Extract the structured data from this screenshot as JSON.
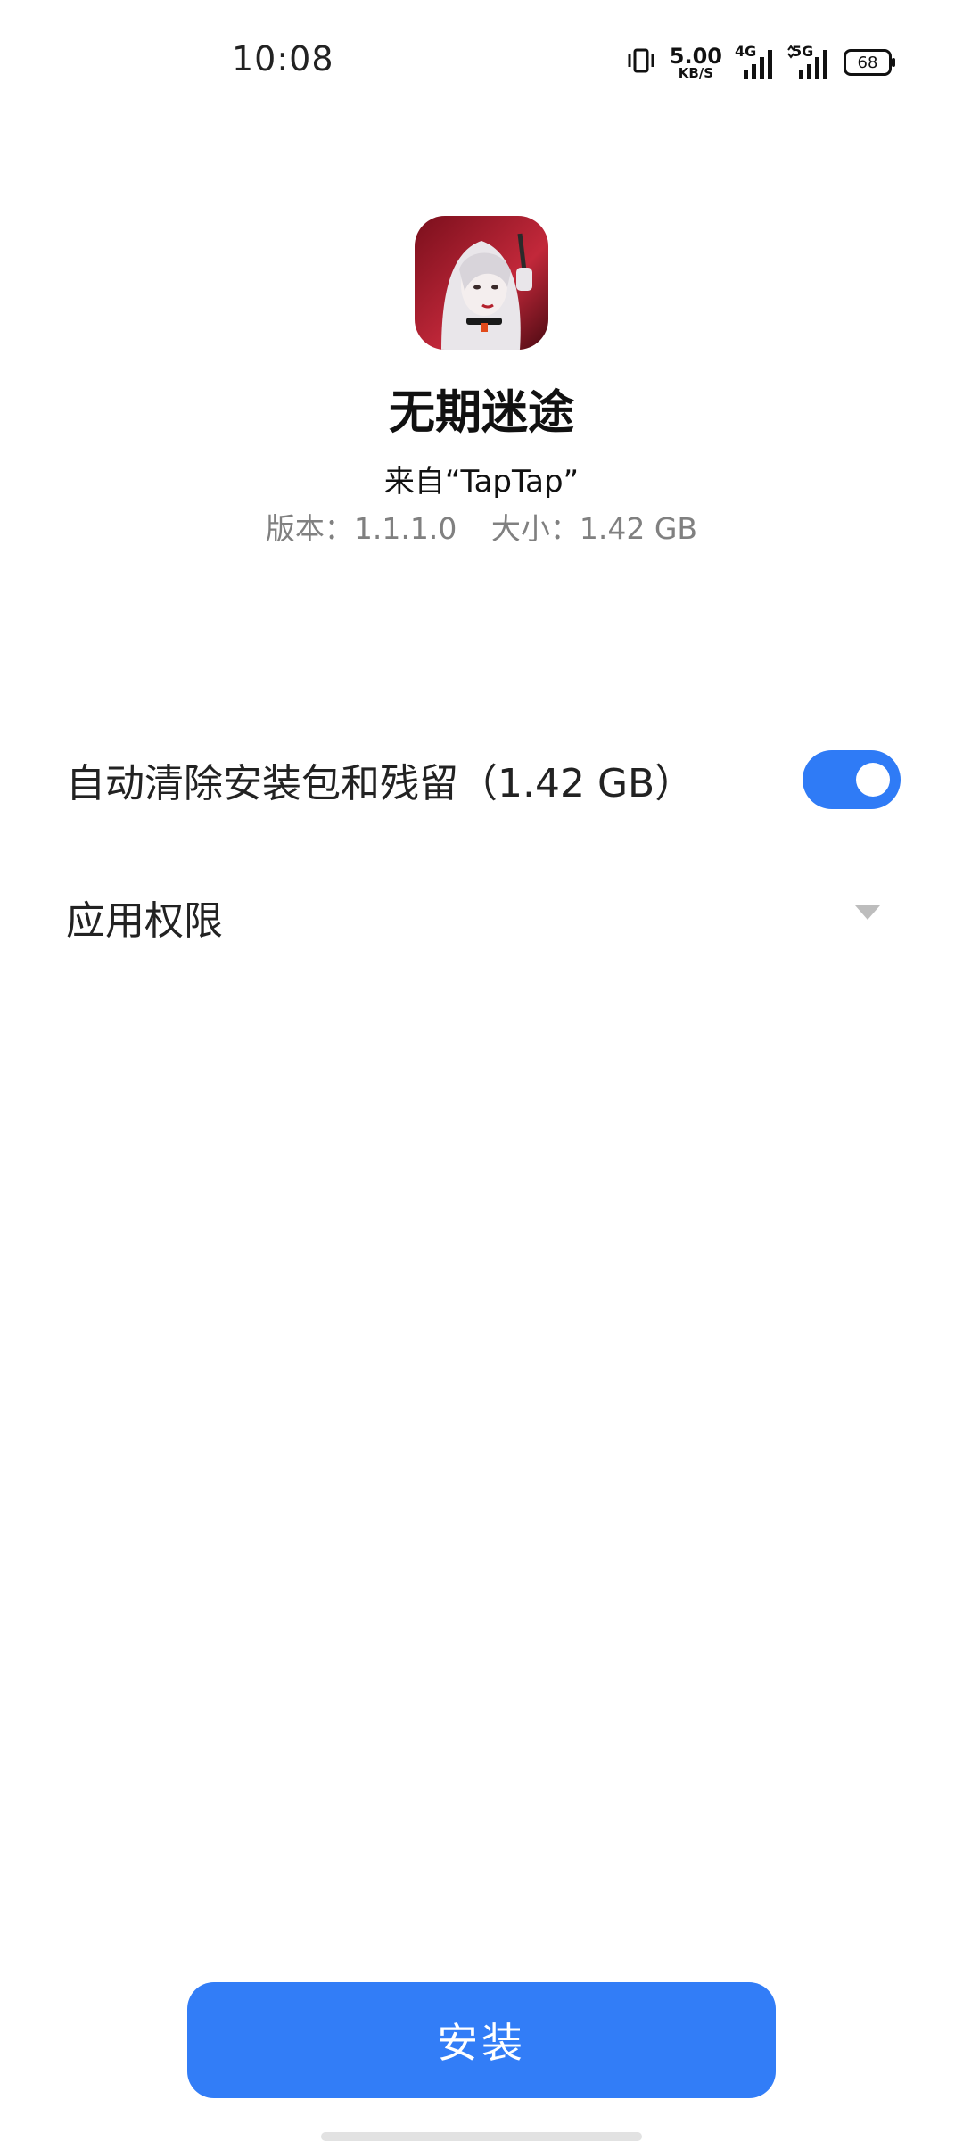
{
  "status_bar": {
    "time": "10:08",
    "net_speed_value": "5.00",
    "net_speed_unit": "KB/S",
    "signal1_label": "4G",
    "signal2_label": "5G",
    "battery": "68",
    "icons": [
      "vibrate-icon",
      "signal-4g-icon",
      "signal-5g-icon",
      "battery-icon"
    ]
  },
  "app": {
    "name": "无期迷途",
    "source": "来自“TapTap”",
    "version": "版本：1.1.1.0",
    "size": "大小：1.42 GB"
  },
  "options": {
    "auto_clean_label": "自动清除安装包和残留（1.42 GB）",
    "auto_clean_enabled": true,
    "permissions_label": "应用权限"
  },
  "actions": {
    "install_label": "安装"
  },
  "colors": {
    "accent": "#327df7",
    "meta_text": "#808080"
  }
}
